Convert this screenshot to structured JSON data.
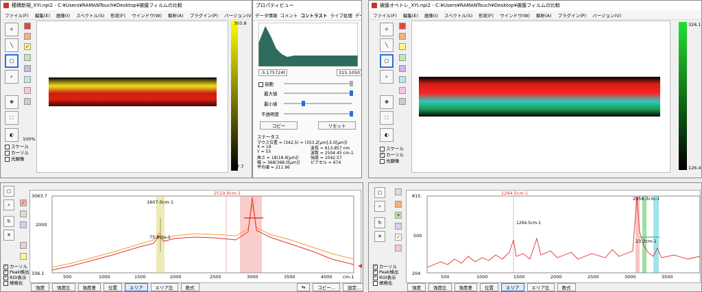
{
  "left_window": {
    "title": "穂積新規_XYI.npi2 - C:¥Users¥RAMANTouch¥Desktop¥被膜フィルムの比較",
    "menu": [
      "ファイル(F)",
      "編集(E)",
      "画像(I)",
      "スペクトル(S)",
      "形状(F)",
      "ウインドウ(W)",
      "解析(A)",
      "プラグイン(P)",
      "バージョン(V)"
    ],
    "colorbar_max": "303.8",
    "colorbar_min": "77.7",
    "zoom": "100%",
    "checks": [
      "スケール",
      "カーソル",
      "光顕像"
    ],
    "spectrum": {
      "ymax": "3063.7",
      "ymid": "2000",
      "ymin": "336.1",
      "xticks": [
        "500",
        "1000",
        "1500",
        "2000",
        "2500",
        "3000",
        "3500",
        "4000"
      ],
      "xunit": "cm-1",
      "cursor_top": "2519.9cm-1",
      "peak_label": "1607.0cm-1",
      "width_label": "75.8cm-1"
    },
    "bottom_checks": [
      "カーソル",
      "Peak検出",
      "ROI表示",
      "規格化"
    ],
    "buttons": [
      "強度",
      "強度比",
      "強度差",
      "位置",
      "エリア",
      "エリア比",
      "数式"
    ],
    "right_buttons": [
      "⇆",
      "コピー...",
      "設定..."
    ]
  },
  "property_view": {
    "title": "プロパティビュー",
    "tabs": [
      "データ情報",
      "コメント",
      "コントラスト",
      "ライブ処理",
      "データ"
    ],
    "hist_min": "-5.175724t",
    "hist_max": "315.10507",
    "auto": "自動",
    "max": "最大値",
    "min": "最小値",
    "opacity": "不透明度",
    "copy": "コピー",
    "reset": "リセット",
    "status_title": "ステータス",
    "status": [
      "マウス位置 = (342,5) = (353.2[µm],5.0[µm])",
      "X = 19",
      "Y = 55",
      "高さ = 18(18.6[µm])",
      "幅 = 368(368.0[µm])",
      "平均値 = 211.96",
      "波長 = 613.857 nm",
      "波数 = 2504.45 cm-1",
      "強度 = 1042.57",
      "ピクセル = 674"
    ]
  },
  "right_window": {
    "title": "被膜オベトレ_XYI.npi2 - C:¥Users¥RAMANTouch¥Desktop¥被膜フィルムの比較",
    "menu": [
      "ファイル(F)",
      "編集(E)",
      "画像(I)",
      "スペクトル(S)",
      "形状(F)",
      "ウインドウ(W)",
      "解析(A)",
      "プラグイン(P)",
      "バージョン(V)"
    ],
    "colorbar_max": "326.1",
    "colorbar_min": "126.4",
    "checks": [
      "スケール",
      "カーソル",
      "光顕像"
    ],
    "spectrum": {
      "ymax": "815",
      "ymid": "500",
      "ymin": "204",
      "xticks": [
        "500",
        "1000",
        "1500",
        "2000",
        "2500",
        "3000",
        "3500"
      ],
      "cursor_top": "1294.5cm-1",
      "cursor_label": "1294.5cm-1",
      "peak_label": "2956.3cm-1",
      "width_label": "23.3cm-1"
    },
    "bottom_checks": [
      "カーソル",
      "Peak検出",
      "ROI表示",
      "規格化"
    ],
    "buttons": [
      "強度",
      "強度比",
      "強度差",
      "位置",
      "エリア",
      "エリア比",
      "数式"
    ]
  },
  "colors": {
    "accent": "#2b6fd6",
    "red": "#e23030",
    "orange": "#f29a2e",
    "green": "#2fbf3a",
    "cyan": "#3cc8d0"
  }
}
